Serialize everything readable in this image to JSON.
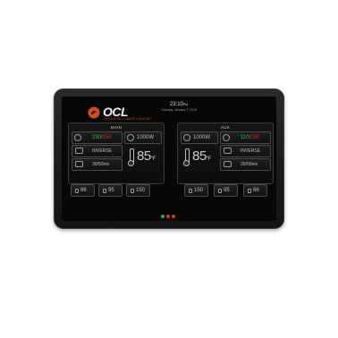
{
  "brand": {
    "logo_text": "OCL",
    "tagline": "OFFSHORE CLIMATE LIGHTING"
  },
  "clock": {
    "time": "23:10",
    "ampm": "PM",
    "date": "Tuesday, January 7, 2019"
  },
  "main_panel": {
    "title": "MAIN",
    "voltage_green": "230",
    "voltage_red": "150",
    "power": "1000W",
    "mode": "INVERSE",
    "range": "30/50ms",
    "temp": "85",
    "temp_unit": "°F"
  },
  "aux_panel": {
    "title": "AUX",
    "power": "1000W",
    "voltage_green": "110",
    "voltage_red": "150",
    "mode": "INVERSE",
    "range": "30/50ms",
    "temp": "85",
    "temp_unit": "°F"
  },
  "bottom_buttons": {
    "main": [
      "86",
      "95",
      "150"
    ],
    "aux": [
      "150",
      "95",
      "86"
    ]
  },
  "status_colors": {
    "green": "#2ea84a",
    "red1": "#d0362e",
    "red2": "#d0362e"
  }
}
